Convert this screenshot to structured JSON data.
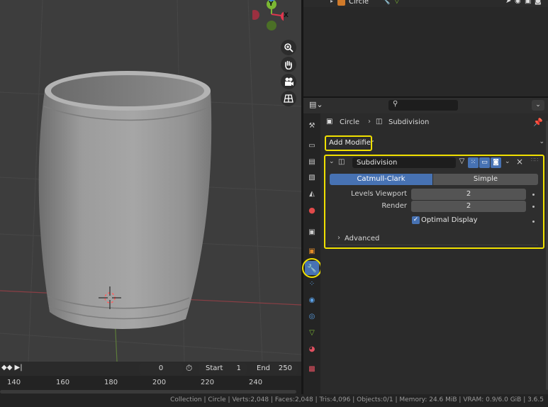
{
  "outliner": {
    "object_name": "Circle"
  },
  "properties": {
    "search_placeholder": "",
    "breadcrumb": {
      "object": "Circle",
      "modifier": "Subdivision"
    },
    "add_modifier_label": "Add Modifier",
    "modifier": {
      "name": "Subdivision",
      "segment": {
        "options": [
          "Catmull-Clark",
          "Simple"
        ],
        "selected": "Catmull-Clark"
      },
      "levels_viewport_label": "Levels Viewport",
      "levels_viewport_value": "2",
      "render_label": "Render",
      "render_value": "2",
      "optimal_display_label": "Optimal Display",
      "optimal_display_checked": true,
      "advanced_label": "Advanced"
    },
    "tabs": [
      "tool-icon",
      "render-icon",
      "output-icon",
      "view-layer-icon",
      "scene-icon",
      "world-icon",
      "collection-icon",
      "object-icon",
      "wrench-icon",
      "particles-icon",
      "physics-icon",
      "constraints-icon",
      "data-icon",
      "material-icon",
      "texture-icon"
    ]
  },
  "timeline": {
    "current_frame": "0",
    "start_label": "Start",
    "start_value": "1",
    "end_label": "End",
    "end_value": "250",
    "ticks": [
      "140",
      "160",
      "180",
      "200",
      "220",
      "240"
    ]
  },
  "statusbar": {
    "text": "Collection | Circle | Verts:2,048 | Faces:2,048 | Tris:4,096 | Objects:0/1 | Memory: 24.6 MiB | VRAM: 0.9/6.0 GiB | 3.6.5"
  },
  "gizmo": {
    "y_label": "Y",
    "x_label": "X"
  },
  "colors": {
    "highlight": "#f0e000",
    "accent": "#4772b3",
    "x_axis": "#e0364e",
    "y_axis": "#7bb833",
    "z_axis": "#3b86d6"
  }
}
